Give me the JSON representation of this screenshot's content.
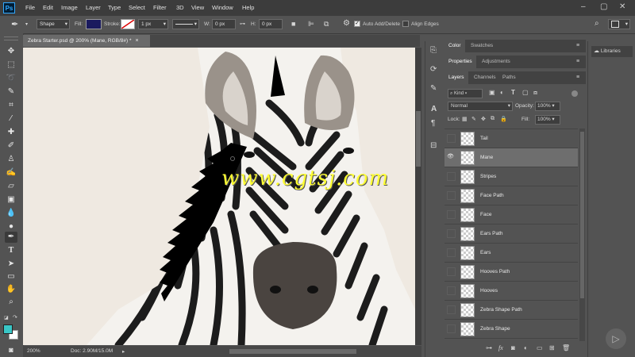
{
  "menubar": {
    "app_logo": "Ps",
    "items": [
      "File",
      "Edit",
      "Image",
      "Layer",
      "Type",
      "Select",
      "Filter",
      "3D",
      "View",
      "Window",
      "Help"
    ],
    "window_controls": [
      "–",
      "▢",
      "✕"
    ]
  },
  "optionsbar": {
    "mode": "Shape",
    "fill_label": "Fill:",
    "stroke_label": "Stroke:",
    "stroke_width": "1 px",
    "w_label": "W:",
    "w_value": "0 px",
    "h_label": "H:",
    "h_value": "0 px",
    "auto_add_delete": "Auto Add/Delete",
    "align_edges": "Align Edges",
    "fill_color": "#1a1a5e"
  },
  "document": {
    "tab_title": "Zebra Starter.psd @ 200% (Mane, RGB/8#) *",
    "watermark": "www.cgtsj.com",
    "zoom": "200%",
    "doc_info": "Doc: 2.90M/15.0M"
  },
  "panels": {
    "top_tabs": [
      "Color",
      "Swatches"
    ],
    "mid_tabs": [
      "Properties",
      "Adjustments"
    ],
    "layer_tabs": [
      "Layers",
      "Channels",
      "Paths"
    ],
    "libraries": "Libraries",
    "filter_kind": "Kind",
    "blend_mode": "Normal",
    "opacity_label": "Opacity:",
    "opacity_value": "100%",
    "lock_label": "Lock:",
    "fill_label": "Fill:",
    "fill_value": "100%"
  },
  "layers": [
    {
      "name": "Tail",
      "visible": false,
      "selected": false
    },
    {
      "name": "Mane",
      "visible": true,
      "selected": true
    },
    {
      "name": "Stripes",
      "visible": false,
      "selected": false
    },
    {
      "name": "Face Path",
      "visible": false,
      "selected": false
    },
    {
      "name": "Face",
      "visible": false,
      "selected": false
    },
    {
      "name": "Ears Path",
      "visible": false,
      "selected": false
    },
    {
      "name": "Ears",
      "visible": false,
      "selected": false
    },
    {
      "name": "Hooves Path",
      "visible": false,
      "selected": false
    },
    {
      "name": "Hooves",
      "visible": false,
      "selected": false
    },
    {
      "name": "Zebra Shape Path",
      "visible": false,
      "selected": false
    },
    {
      "name": "Zebra Shape",
      "visible": false,
      "selected": false
    }
  ],
  "colors": {
    "foreground": "#39c6c6",
    "background": "#ffffff",
    "watermark": "#ffff33"
  }
}
